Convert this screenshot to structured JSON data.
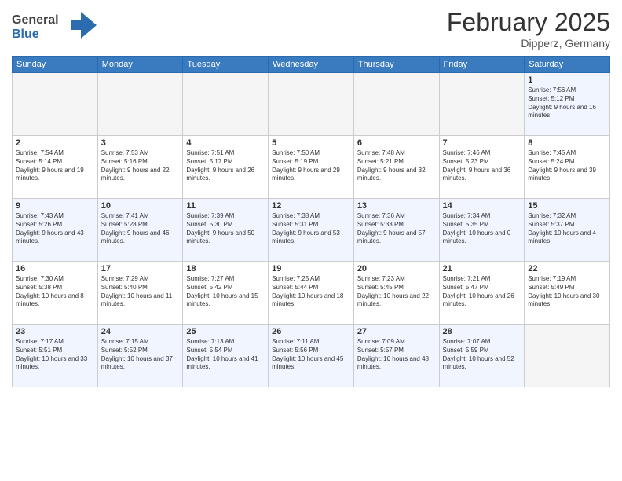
{
  "header": {
    "logo_general": "General",
    "logo_blue": "Blue",
    "month_year": "February 2025",
    "location": "Dipperz, Germany"
  },
  "columns": [
    "Sunday",
    "Monday",
    "Tuesday",
    "Wednesday",
    "Thursday",
    "Friday",
    "Saturday"
  ],
  "weeks": [
    {
      "days": [
        {
          "num": "",
          "info": ""
        },
        {
          "num": "",
          "info": ""
        },
        {
          "num": "",
          "info": ""
        },
        {
          "num": "",
          "info": ""
        },
        {
          "num": "",
          "info": ""
        },
        {
          "num": "",
          "info": ""
        },
        {
          "num": "1",
          "info": "Sunrise: 7:56 AM\nSunset: 5:12 PM\nDaylight: 9 hours and 16 minutes."
        }
      ]
    },
    {
      "days": [
        {
          "num": "2",
          "info": "Sunrise: 7:54 AM\nSunset: 5:14 PM\nDaylight: 9 hours and 19 minutes."
        },
        {
          "num": "3",
          "info": "Sunrise: 7:53 AM\nSunset: 5:16 PM\nDaylight: 9 hours and 22 minutes."
        },
        {
          "num": "4",
          "info": "Sunrise: 7:51 AM\nSunset: 5:17 PM\nDaylight: 9 hours and 26 minutes."
        },
        {
          "num": "5",
          "info": "Sunrise: 7:50 AM\nSunset: 5:19 PM\nDaylight: 9 hours and 29 minutes."
        },
        {
          "num": "6",
          "info": "Sunrise: 7:48 AM\nSunset: 5:21 PM\nDaylight: 9 hours and 32 minutes."
        },
        {
          "num": "7",
          "info": "Sunrise: 7:46 AM\nSunset: 5:23 PM\nDaylight: 9 hours and 36 minutes."
        },
        {
          "num": "8",
          "info": "Sunrise: 7:45 AM\nSunset: 5:24 PM\nDaylight: 9 hours and 39 minutes."
        }
      ]
    },
    {
      "days": [
        {
          "num": "9",
          "info": "Sunrise: 7:43 AM\nSunset: 5:26 PM\nDaylight: 9 hours and 43 minutes."
        },
        {
          "num": "10",
          "info": "Sunrise: 7:41 AM\nSunset: 5:28 PM\nDaylight: 9 hours and 46 minutes."
        },
        {
          "num": "11",
          "info": "Sunrise: 7:39 AM\nSunset: 5:30 PM\nDaylight: 9 hours and 50 minutes."
        },
        {
          "num": "12",
          "info": "Sunrise: 7:38 AM\nSunset: 5:31 PM\nDaylight: 9 hours and 53 minutes."
        },
        {
          "num": "13",
          "info": "Sunrise: 7:36 AM\nSunset: 5:33 PM\nDaylight: 9 hours and 57 minutes."
        },
        {
          "num": "14",
          "info": "Sunrise: 7:34 AM\nSunset: 5:35 PM\nDaylight: 10 hours and 0 minutes."
        },
        {
          "num": "15",
          "info": "Sunrise: 7:32 AM\nSunset: 5:37 PM\nDaylight: 10 hours and 4 minutes."
        }
      ]
    },
    {
      "days": [
        {
          "num": "16",
          "info": "Sunrise: 7:30 AM\nSunset: 5:38 PM\nDaylight: 10 hours and 8 minutes."
        },
        {
          "num": "17",
          "info": "Sunrise: 7:29 AM\nSunset: 5:40 PM\nDaylight: 10 hours and 11 minutes."
        },
        {
          "num": "18",
          "info": "Sunrise: 7:27 AM\nSunset: 5:42 PM\nDaylight: 10 hours and 15 minutes."
        },
        {
          "num": "19",
          "info": "Sunrise: 7:25 AM\nSunset: 5:44 PM\nDaylight: 10 hours and 18 minutes."
        },
        {
          "num": "20",
          "info": "Sunrise: 7:23 AM\nSunset: 5:45 PM\nDaylight: 10 hours and 22 minutes."
        },
        {
          "num": "21",
          "info": "Sunrise: 7:21 AM\nSunset: 5:47 PM\nDaylight: 10 hours and 26 minutes."
        },
        {
          "num": "22",
          "info": "Sunrise: 7:19 AM\nSunset: 5:49 PM\nDaylight: 10 hours and 30 minutes."
        }
      ]
    },
    {
      "days": [
        {
          "num": "23",
          "info": "Sunrise: 7:17 AM\nSunset: 5:51 PM\nDaylight: 10 hours and 33 minutes."
        },
        {
          "num": "24",
          "info": "Sunrise: 7:15 AM\nSunset: 5:52 PM\nDaylight: 10 hours and 37 minutes."
        },
        {
          "num": "25",
          "info": "Sunrise: 7:13 AM\nSunset: 5:54 PM\nDaylight: 10 hours and 41 minutes."
        },
        {
          "num": "26",
          "info": "Sunrise: 7:11 AM\nSunset: 5:56 PM\nDaylight: 10 hours and 45 minutes."
        },
        {
          "num": "27",
          "info": "Sunrise: 7:09 AM\nSunset: 5:57 PM\nDaylight: 10 hours and 48 minutes."
        },
        {
          "num": "28",
          "info": "Sunrise: 7:07 AM\nSunset: 5:59 PM\nDaylight: 10 hours and 52 minutes."
        },
        {
          "num": "",
          "info": ""
        }
      ]
    }
  ]
}
